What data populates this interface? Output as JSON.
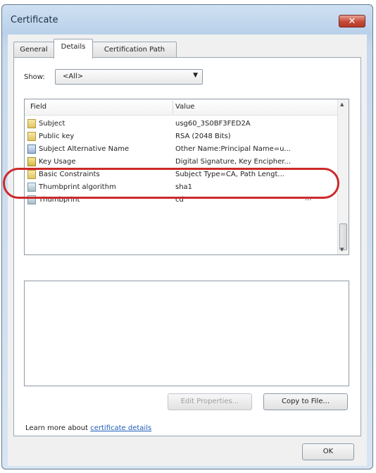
{
  "window": {
    "title": "Certificate",
    "close_glyph": "✕"
  },
  "tabs": [
    {
      "label": "General"
    },
    {
      "label": "Details"
    },
    {
      "label": "Certification Path"
    }
  ],
  "show": {
    "label": "Show:",
    "selected": "<All>"
  },
  "columns": {
    "field": "Field",
    "value": "Value"
  },
  "rows": [
    {
      "field": "Subject",
      "value": "usg60_3S0BF3FED2A",
      "icon": "certificate-field-icon"
    },
    {
      "field": "Public key",
      "value": "RSA (2048 Bits)",
      "icon": "certificate-field-icon"
    },
    {
      "field": "Subject Alternative Name",
      "value": "Other Name:Principal Name=u...",
      "icon": "extension-icon"
    },
    {
      "field": "Key Usage",
      "value": "Digital Signature, Key Encipher...",
      "icon": "key-usage-icon"
    },
    {
      "field": "Basic Constraints",
      "value": "Subject Type=CA, Path Lengt...",
      "icon": "certificate-field-icon"
    },
    {
      "field": "Thumbprint algorithm",
      "value": "sha1",
      "icon": "thumbprint-icon"
    },
    {
      "field": "Thumbprint",
      "value": "cd",
      "more": "...",
      "icon": "thumbprint-icon"
    }
  ],
  "buttons": {
    "edit_properties": "Edit Properties...",
    "copy_to_file": "Copy to File...",
    "ok": "OK"
  },
  "learn": {
    "prefix": "Learn more about ",
    "link": "certificate details"
  },
  "colors": {
    "highlight": "#cc2a2a",
    "link": "#1f5db8"
  }
}
